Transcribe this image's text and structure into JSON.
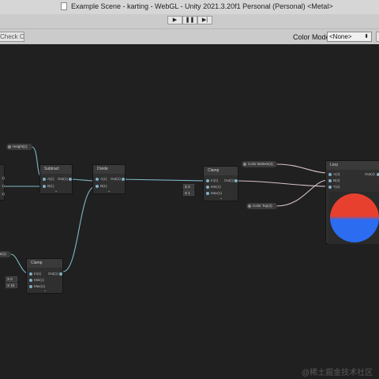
{
  "window": {
    "title": "Example Scene - karting - WebGL - Unity 2021.3.20f1 Personal (Personal) <Metal>"
  },
  "playback": {
    "play": "▶",
    "pause": "❚❚",
    "step": "▶|"
  },
  "graph_toolbar": {
    "check_out": "Check Out",
    "color_mode_label": "Color Mode",
    "color_mode_value": "<None>"
  },
  "nodes": {
    "subtract": {
      "title": "Subtract",
      "in_a": "A(1)",
      "in_b": "B(1)",
      "out": "Out(1)"
    },
    "divide": {
      "title": "Divide",
      "in_a": "A(1)",
      "in_b": "B(1)",
      "out": "Out(1)"
    },
    "clamp_right": {
      "title": "Clamp",
      "in": "In(1)",
      "min": "Min(1)",
      "max": "Max(1)",
      "out": "Out(1)",
      "min_field": "X 0",
      "max_field": "X 1"
    },
    "clamp_left": {
      "title": "Clamp",
      "in": "In(1)",
      "min": "Min(1)",
      "max": "Max(1)",
      "out": "Out(1)",
      "min_field": "X 0",
      "max_field": "X 10"
    },
    "lerp": {
      "title": "Lerp",
      "in_a": "A(4)",
      "in_b": "B(4)",
      "in_t": "T(4)",
      "out": "Out(4)"
    }
  },
  "properties": {
    "height": "Height(1)",
    "color_bottom": "Color Bottom(4)",
    "color_top": "Color Top(4)",
    "left_partial": "ase(1)"
  },
  "left_partial_labels": [
    "1)",
    "1)",
    "1)"
  ],
  "colors": {
    "preview_top": "#e8402f",
    "preview_bottom": "#2b6cf0",
    "wire": "#7fb8c4",
    "color_wire": "#d8c0cc"
  },
  "watermark": "@稀土掘金技术社区"
}
